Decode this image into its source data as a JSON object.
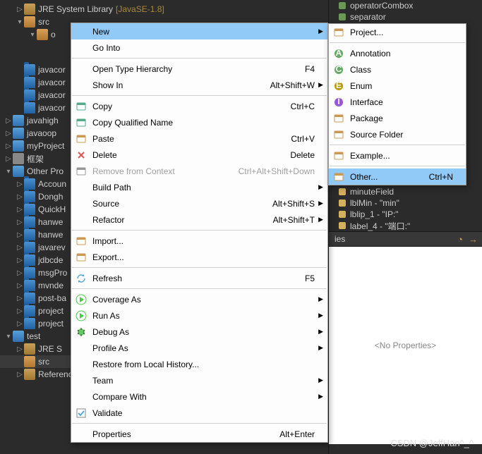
{
  "tree": {
    "jre": {
      "label": "JRE System Library",
      "decorator": "[JavaSE-1.8]"
    },
    "src": "src",
    "pkg_o": "o",
    "folders": [
      "javacor",
      "javacor",
      "javacor",
      "javacor"
    ],
    "projects": [
      "javahigh",
      "javaoop",
      "myProject",
      "框架",
      "Other Pro"
    ],
    "subfolders": [
      "Accoun",
      "Dongh",
      "QuickH",
      "hanwe",
      "hanwe",
      "javarev",
      "jdbcde",
      "msgPro",
      "mvnde",
      "post-ba",
      "project",
      "project"
    ],
    "test": "test",
    "test_jre": "JRE S",
    "test_src": "src",
    "ref_lib": "Referenced Libraries"
  },
  "outline": {
    "items": [
      {
        "label": "operatorCombox"
      },
      {
        "label": "separator"
      },
      {
        "label": "minuteField"
      },
      {
        "label": "lblMin - \"min\""
      },
      {
        "label": "lblip_1 - \"IP:\""
      },
      {
        "label": "label_4 - \"端口:\""
      }
    ]
  },
  "props": {
    "tab": "ies",
    "empty": "<No Properties>"
  },
  "menu": {
    "items": [
      {
        "label": "New",
        "arrow": true,
        "sel": true
      },
      {
        "label": "Go Into"
      },
      {
        "sep": true
      },
      {
        "label": "Open Type Hierarchy",
        "short": "F4"
      },
      {
        "label": "Show In",
        "short": "Alt+Shift+W",
        "arrow": true
      },
      {
        "sep": true
      },
      {
        "label": "Copy",
        "short": "Ctrl+C",
        "icon": "copy"
      },
      {
        "label": "Copy Qualified Name",
        "icon": "copyq"
      },
      {
        "label": "Paste",
        "short": "Ctrl+V",
        "icon": "paste"
      },
      {
        "label": "Delete",
        "short": "Delete",
        "icon": "delete"
      },
      {
        "label": "Remove from Context",
        "short": "Ctrl+Alt+Shift+Down",
        "icon": "remove",
        "dis": true
      },
      {
        "label": "Build Path",
        "arrow": true
      },
      {
        "label": "Source",
        "short": "Alt+Shift+S",
        "arrow": true
      },
      {
        "label": "Refactor",
        "short": "Alt+Shift+T",
        "arrow": true
      },
      {
        "sep": true
      },
      {
        "label": "Import...",
        "icon": "import"
      },
      {
        "label": "Export...",
        "icon": "export"
      },
      {
        "sep": true
      },
      {
        "label": "Refresh",
        "short": "F5",
        "icon": "refresh"
      },
      {
        "sep": true
      },
      {
        "label": "Coverage As",
        "arrow": true,
        "icon": "coverage"
      },
      {
        "label": "Run As",
        "arrow": true,
        "icon": "run"
      },
      {
        "label": "Debug As",
        "arrow": true,
        "icon": "debug"
      },
      {
        "label": "Profile As",
        "arrow": true
      },
      {
        "label": "Restore from Local History..."
      },
      {
        "label": "Team",
        "arrow": true
      },
      {
        "label": "Compare With",
        "arrow": true
      },
      {
        "label": "Validate",
        "icon": "validate"
      },
      {
        "sep": true
      },
      {
        "label": "Properties",
        "short": "Alt+Enter"
      }
    ]
  },
  "submenu": {
    "items": [
      {
        "label": "Project...",
        "icon": "proj"
      },
      {
        "sep": true
      },
      {
        "label": "Annotation",
        "icon": "anno"
      },
      {
        "label": "Class",
        "icon": "class"
      },
      {
        "label": "Enum",
        "icon": "enum"
      },
      {
        "label": "Interface",
        "icon": "iface"
      },
      {
        "label": "Package",
        "icon": "pkg"
      },
      {
        "label": "Source Folder",
        "icon": "srcf"
      },
      {
        "sep": true
      },
      {
        "label": "Example...",
        "icon": "ex"
      },
      {
        "sep": true
      },
      {
        "label": "Other...",
        "short": "Ctrl+N",
        "icon": "other",
        "sel": true
      }
    ]
  },
  "watermark": "CSDN @JeffHan^_^"
}
